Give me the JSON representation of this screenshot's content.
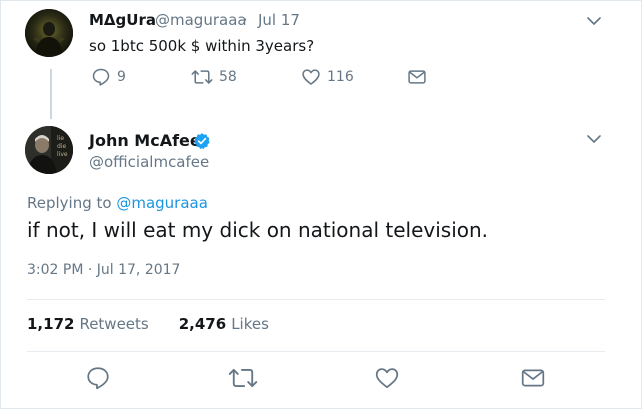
{
  "parent_tweet": {
    "display_name": "MΔgUra",
    "handle": "@maguraaa",
    "separator": "·",
    "date": "Jul 17",
    "text": "so 1btc 500k $ within 3years?",
    "reply_count": "9",
    "retweet_count": "58",
    "like_count": "116"
  },
  "main_tweet": {
    "display_name": "John McAfee",
    "verified": true,
    "handle": "@officialmcafee",
    "replying_to_prefix": "Replying to ",
    "replying_to_handle": "@maguraaa",
    "text": "if not, I will eat my dick on national television.",
    "timestamp": "3:02 PM · Jul 17, 2017",
    "retweets": "1,172",
    "retweets_label": "Retweets",
    "likes": "2,476",
    "likes_label": "Likes"
  },
  "colors": {
    "text": "#14171a",
    "muted": "#657786",
    "link": "#1b95e0",
    "verified": "#1da1f2",
    "divider": "#e6ecf0"
  },
  "icons": [
    "chevron-down-icon",
    "reply-icon",
    "retweet-icon",
    "like-heart-icon",
    "direct-message-icon",
    "verified-badge-icon"
  ]
}
